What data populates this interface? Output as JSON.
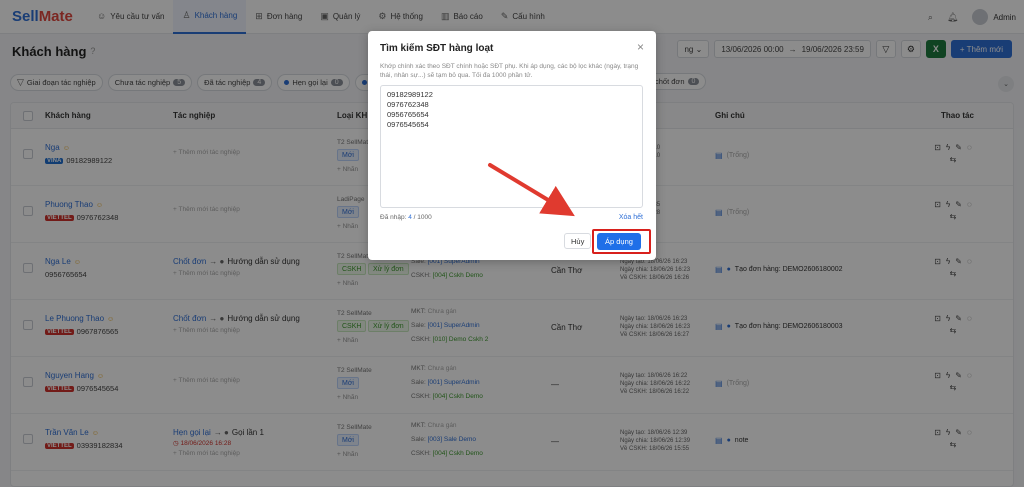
{
  "app": {
    "logo_a": "Sell",
    "logo_b": "Mate"
  },
  "nav": [
    {
      "label": "Yêu cầu tư vấn",
      "icon": "☺"
    },
    {
      "label": "Khách hàng",
      "icon": "♙"
    },
    {
      "label": "Đơn hàng",
      "icon": "⊞"
    },
    {
      "label": "Quản lý",
      "icon": "▣"
    },
    {
      "label": "Hệ thống",
      "icon": "⚙"
    },
    {
      "label": "Báo cáo",
      "icon": "▥"
    },
    {
      "label": "Cấu hình",
      "icon": "✎"
    }
  ],
  "user": {
    "name": "Admin"
  },
  "page": {
    "title": "Khách hàng",
    "help_icon": "?"
  },
  "toolbar": {
    "select_label": "ng",
    "date_from": "13/06/2026 00:00",
    "date_sep": "→",
    "date_to": "19/06/2026 23:59",
    "add_label": "+ Thêm mới",
    "excel_label": "X"
  },
  "filters": {
    "stage": "Giai đoạn tác nghiệp",
    "chips": [
      {
        "label": "Chưa tác nghiệp",
        "count": "5"
      },
      {
        "label": "Đã tác nghiệp",
        "count": "4"
      },
      {
        "label": "Hẹn gọi lại",
        "count": "0",
        "dot": "#2f6fd6"
      },
      {
        "label": "Gọi lần",
        "count": "",
        "dot": "#2f6fd6"
      }
    ],
    "chip_right": {
      "label": "chốt đơn",
      "count": "0"
    }
  },
  "table": {
    "headers": {
      "customer": "Khách hàng",
      "task": "Tác nghiệp",
      "type": "Loại KH",
      "note": "Ghi chú",
      "actions": "Thao tác"
    },
    "rows": [
      {
        "name": "Nga",
        "carrier": "VINA",
        "carrier_class": "vina",
        "phone": "09182989122",
        "stage": "",
        "sub": "",
        "date": "",
        "add": "+ Thêm mới tác nghiệp",
        "src": "T2 SellMate",
        "badge": "Mới",
        "badge2": "",
        "more": "+ Nhãn",
        "ps": [],
        "area": "",
        "times": [
          "19/06/26 22:10",
          "19/06/26 22:10"
        ],
        "note": "(Trống)",
        "note_muted": true
      },
      {
        "name": "Phuong Thao",
        "carrier": "VIETTEL",
        "carrier_class": "viettel",
        "phone": "0976762348",
        "stage": "",
        "sub": "",
        "date": "",
        "add": "+ Thêm mới tác nghiệp",
        "src": "LadiPage",
        "badge": "Mới",
        "badge2": "",
        "more": "+ Nhãn",
        "ps": [],
        "area": "",
        "times": [
          "19/06/26 20:35",
          "19/06/26 10:28"
        ],
        "note": "(Trống)",
        "note_muted": true
      },
      {
        "name": "Nga Le",
        "carrier": "",
        "carrier_class": "",
        "phone": "0956765654",
        "stage": "Chốt đơn",
        "sub": "Hướng dẫn sử dụng",
        "date": "",
        "add": "+ Thêm mới tác nghiệp",
        "src": "T2 SellMate",
        "badge": "CSKH",
        "badge2": "Xử lý đơn",
        "more": "+ Nhãn",
        "ps": [
          {
            "l": "Sale: ",
            "v": "[001] SuperAdmin",
            "c": "v"
          },
          {
            "l": "CSKH: ",
            "v": "[004] Cskh Demo",
            "c": "g"
          }
        ],
        "area": "Cần Thơ",
        "times": [
          "Ngày tạo: 18/06/26 16:23",
          "Ngày chia: 18/06/26 16:23",
          "Về CSKH: 18/06/26 16:26"
        ],
        "note": "Tạo đơn hàng: DEMO2606180002",
        "note_muted": false
      },
      {
        "name": "Le Phuong Thao",
        "carrier": "VIETTEL",
        "carrier_class": "viettel",
        "phone": "0967876565",
        "stage": "Chốt đơn",
        "sub": "Hướng dẫn sử dụng",
        "date": "",
        "add": "+ Thêm mới tác nghiệp",
        "src": "T2 SellMate",
        "badge": "CSKH",
        "badge2": "Xử lý đơn",
        "more": "+ Nhãn",
        "ps": [
          {
            "l": "MKT: ",
            "v": "Chưa gán",
            "c": "muted"
          },
          {
            "l": "Sale: ",
            "v": "[001] SuperAdmin",
            "c": "v"
          },
          {
            "l": "CSKH: ",
            "v": "[010] Demo Cskh 2",
            "c": "g"
          }
        ],
        "area": "Cần Thơ",
        "times": [
          "Ngày tạo: 18/06/26 16:23",
          "Ngày chia: 18/06/26 16:23",
          "Về CSKH: 18/06/26 16:27"
        ],
        "note": "Tạo đơn hàng: DEMO2606180003",
        "note_muted": false
      },
      {
        "name": "Nguyen Hang",
        "carrier": "VIETTEL",
        "carrier_class": "viettel",
        "phone": "0976545654",
        "stage": "",
        "sub": "",
        "date": "",
        "add": "+ Thêm mới tác nghiệp",
        "src": "T2 SellMate",
        "badge": "Mới",
        "badge2": "",
        "more": "+ Nhãn",
        "ps": [
          {
            "l": "MKT: ",
            "v": "Chưa gán",
            "c": "muted"
          },
          {
            "l": "Sale: ",
            "v": "[001] SuperAdmin",
            "c": "v"
          },
          {
            "l": "CSKH: ",
            "v": "[004] Cskh Demo",
            "c": "g"
          }
        ],
        "area": "—",
        "times": [
          "Ngày tạo: 18/06/26 16:22",
          "Ngày chia: 18/06/26 16:22",
          "Về CSKH: 18/06/26 16:22"
        ],
        "note": "(Trống)",
        "note_muted": true
      },
      {
        "name": "Trần Văn Le",
        "carrier": "VIETTEL",
        "carrier_class": "viettel",
        "phone": "03939182834",
        "stage": "Hẹn gọi lại",
        "sub": "Gọi lần 1",
        "date": "◷ 18/06/2026 16:28",
        "add": "+ Thêm mới tác nghiệp",
        "src": "T2 SellMate",
        "badge": "Mới",
        "badge2": "",
        "more": "+ Nhãn",
        "ps": [
          {
            "l": "MKT: ",
            "v": "Chưa gán",
            "c": "muted"
          },
          {
            "l": "Sale: ",
            "v": "[003] Sale Demo",
            "c": "v"
          },
          {
            "l": "CSKH: ",
            "v": "[004] Cskh Demo",
            "c": "g"
          }
        ],
        "area": "—",
        "times": [
          "Ngày tạo: 18/06/26 12:39",
          "Ngày chia: 18/06/26 12:39",
          "Về CSKH: 18/06/26 15:55"
        ],
        "note": "note",
        "note_muted": false
      }
    ]
  },
  "modal": {
    "title": "Tìm kiếm SĐT hàng loạt",
    "close": "×",
    "description": "Khớp chính xác theo SĐT chính hoặc SĐT phụ. Khi áp dụng, các bộ lọc khác (ngày, trạng thái, nhân sự...) sẽ tạm bỏ qua. Tối đa 1000 phần tử.",
    "phones": [
      "09182989122",
      "0976762348",
      "0956765654",
      "0976545654"
    ],
    "count_label": "Đã nhập: ",
    "count_value": "4",
    "count_max": " / 1000",
    "clear_label": "Xóa hết",
    "cancel_label": "Hủy",
    "apply_label": "Áp dụng"
  },
  "colors": {
    "accent": "#2f6fd6",
    "annotation": "#d8201c"
  }
}
